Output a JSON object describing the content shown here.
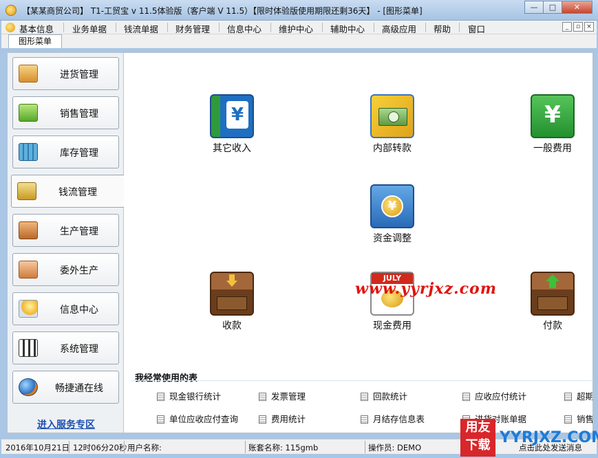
{
  "window": {
    "title": "【某某商贸公司】 T1-工贸宝 v 11.5体验版（客户端 V 11.5）【限时体验版使用期限还剩36天】 - [图形菜单]",
    "controls": {
      "minimize": "—",
      "maximize": "□",
      "close": "✕"
    }
  },
  "menubar": {
    "items": [
      "基本信息",
      "业务单据",
      "钱流单据",
      "财务管理",
      "信息中心",
      "维护中心",
      "辅助中心",
      "高级应用",
      "帮助",
      "窗口"
    ],
    "mdi_controls": [
      "_",
      "▫",
      "×"
    ]
  },
  "tabs": {
    "active": "图形菜单"
  },
  "sidebar": {
    "items": [
      {
        "label": "进货管理",
        "icon": "cart-icon"
      },
      {
        "label": "销售管理",
        "icon": "basket-icon"
      },
      {
        "label": "库存管理",
        "icon": "warehouse-icon"
      },
      {
        "label": "钱流管理",
        "icon": "money-flow-icon"
      },
      {
        "label": "生产管理",
        "icon": "cabinet-icon"
      },
      {
        "label": "委外生产",
        "icon": "inbox-icon"
      },
      {
        "label": "信息中心",
        "icon": "info-bulb-icon"
      },
      {
        "label": "系统管理",
        "icon": "settings-sliders-icon"
      },
      {
        "label": "畅捷通在线",
        "icon": "globe-icon"
      }
    ],
    "service_link": "进入服务专区"
  },
  "main": {
    "functions": [
      {
        "label": "其它收入",
        "icon": "yuan-book-icon"
      },
      {
        "label": "内部转款",
        "icon": "transfer-money-icon"
      },
      {
        "label": "一般费用",
        "icon": "yuan-green-icon"
      },
      {
        "label": "资金调整",
        "icon": "fund-adjust-icon"
      },
      {
        "label": "收款",
        "icon": "receive-drawer-icon"
      },
      {
        "label": "现金费用",
        "icon": "calendar-cash-icon"
      },
      {
        "label": "付款",
        "icon": "pay-drawer-icon"
      }
    ],
    "calendar_month": "JULY",
    "watermark": "www.yyrjxz.com",
    "frequent": {
      "title": "我经常使用的表",
      "row1": [
        "现金银行统计",
        "发票管理",
        "回款统计",
        "应收应付统计",
        "超期"
      ],
      "row2": [
        "单位应收应付查询",
        "费用统计",
        "月结存信息表",
        "进货对账单据",
        "销售"
      ]
    }
  },
  "statusbar": {
    "date": "2016年10月21日",
    "time": "12时06分20秒",
    "user_label": "用户名称:",
    "account_label": "账套名称: 115gmb",
    "operator_label": "操作员: DEMO",
    "tail": "点击此处发送消息"
  },
  "overlay_logo": {
    "badge": "用友下载",
    "site": "YYRJXZ.COM"
  },
  "colors": {
    "titlebar": "#a9c6e4",
    "close_button": "#c7452c",
    "link": "#1b4fb0",
    "watermark": "#e0140f"
  }
}
